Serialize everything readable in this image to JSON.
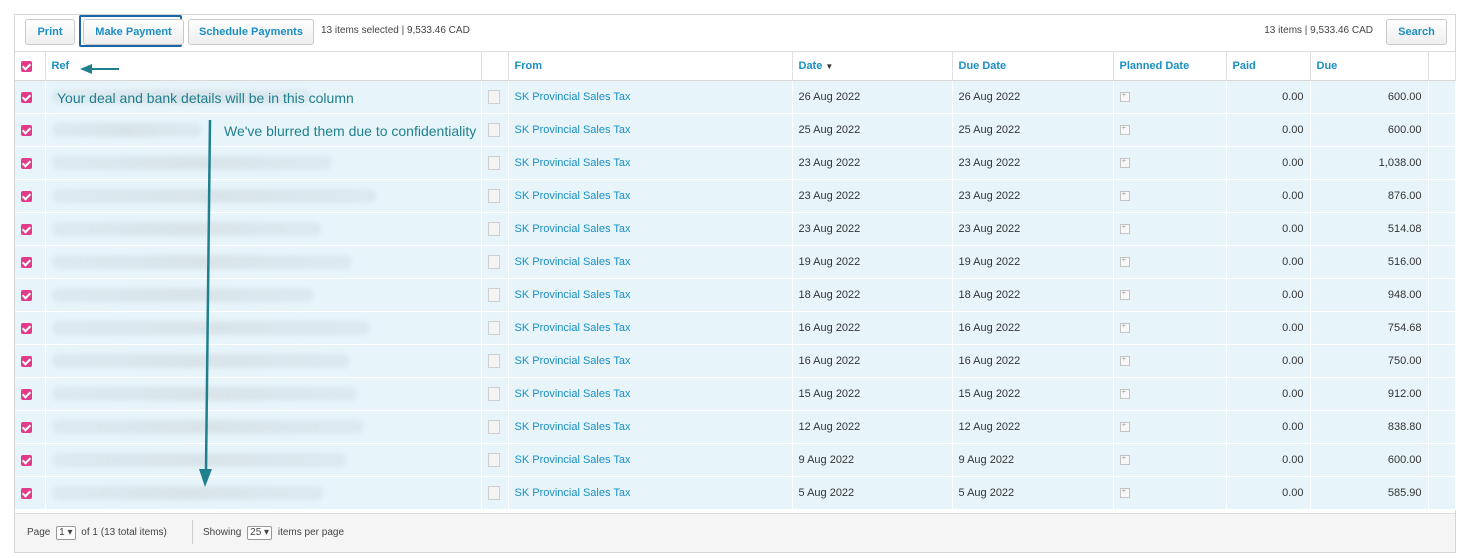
{
  "toolbar": {
    "print_label": "Print",
    "make_payment_label": "Make Payment",
    "schedule_label": "Schedule Payments",
    "selection_info": "13 items selected | 9,533.46 CAD",
    "total_info": "13 items | 9,533.46 CAD",
    "search_label": "Search"
  },
  "columns": {
    "ref": "Ref",
    "from": "From",
    "date": "Date",
    "due_date": "Due Date",
    "planned_date": "Planned Date",
    "paid": "Paid",
    "due": "Due"
  },
  "rows": [
    {
      "from": "SK Provincial Sales Tax",
      "date": "26 Aug 2022",
      "due_date": "26 Aug 2022",
      "paid": "0.00",
      "due": "600.00"
    },
    {
      "from": "SK Provincial Sales Tax",
      "date": "25 Aug 2022",
      "due_date": "25 Aug 2022",
      "paid": "0.00",
      "due": "600.00"
    },
    {
      "from": "SK Provincial Sales Tax",
      "date": "23 Aug 2022",
      "due_date": "23 Aug 2022",
      "paid": "0.00",
      "due": "1,038.00"
    },
    {
      "from": "SK Provincial Sales Tax",
      "date": "23 Aug 2022",
      "due_date": "23 Aug 2022",
      "paid": "0.00",
      "due": "876.00"
    },
    {
      "from": "SK Provincial Sales Tax",
      "date": "23 Aug 2022",
      "due_date": "23 Aug 2022",
      "paid": "0.00",
      "due": "514.08"
    },
    {
      "from": "SK Provincial Sales Tax",
      "date": "19 Aug 2022",
      "due_date": "19 Aug 2022",
      "paid": "0.00",
      "due": "516.00"
    },
    {
      "from": "SK Provincial Sales Tax",
      "date": "18 Aug 2022",
      "due_date": "18 Aug 2022",
      "paid": "0.00",
      "due": "948.00"
    },
    {
      "from": "SK Provincial Sales Tax",
      "date": "16 Aug 2022",
      "due_date": "16 Aug 2022",
      "paid": "0.00",
      "due": "754.68"
    },
    {
      "from": "SK Provincial Sales Tax",
      "date": "16 Aug 2022",
      "due_date": "16 Aug 2022",
      "paid": "0.00",
      "due": "750.00"
    },
    {
      "from": "SK Provincial Sales Tax",
      "date": "15 Aug 2022",
      "due_date": "15 Aug 2022",
      "paid": "0.00",
      "due": "912.00"
    },
    {
      "from": "SK Provincial Sales Tax",
      "date": "12 Aug 2022",
      "due_date": "12 Aug 2022",
      "paid": "0.00",
      "due": "838.80"
    },
    {
      "from": "SK Provincial Sales Tax",
      "date": "9 Aug 2022",
      "due_date": "9 Aug 2022",
      "paid": "0.00",
      "due": "600.00"
    },
    {
      "from": "SK Provincial Sales Tax",
      "date": "5 Aug 2022",
      "due_date": "5 Aug 2022",
      "paid": "0.00",
      "due": "585.90"
    }
  ],
  "footer": {
    "page_label": "Page",
    "page_value": "1",
    "of_label": "of 1 (13 total items)",
    "showing_label": "Showing",
    "per_page_value": "25",
    "per_page_label": "items per page"
  },
  "annotations": {
    "note1": "Your deal and bank details will be in this column",
    "note2": "We've blurred them due to confidentiality"
  },
  "colors": {
    "accent": "#1a8fc4",
    "overdue": "#d9242e",
    "row_bg": "#e7f5fb",
    "checkbox": "#e03c8a",
    "annotation": "#1f7f8d"
  }
}
